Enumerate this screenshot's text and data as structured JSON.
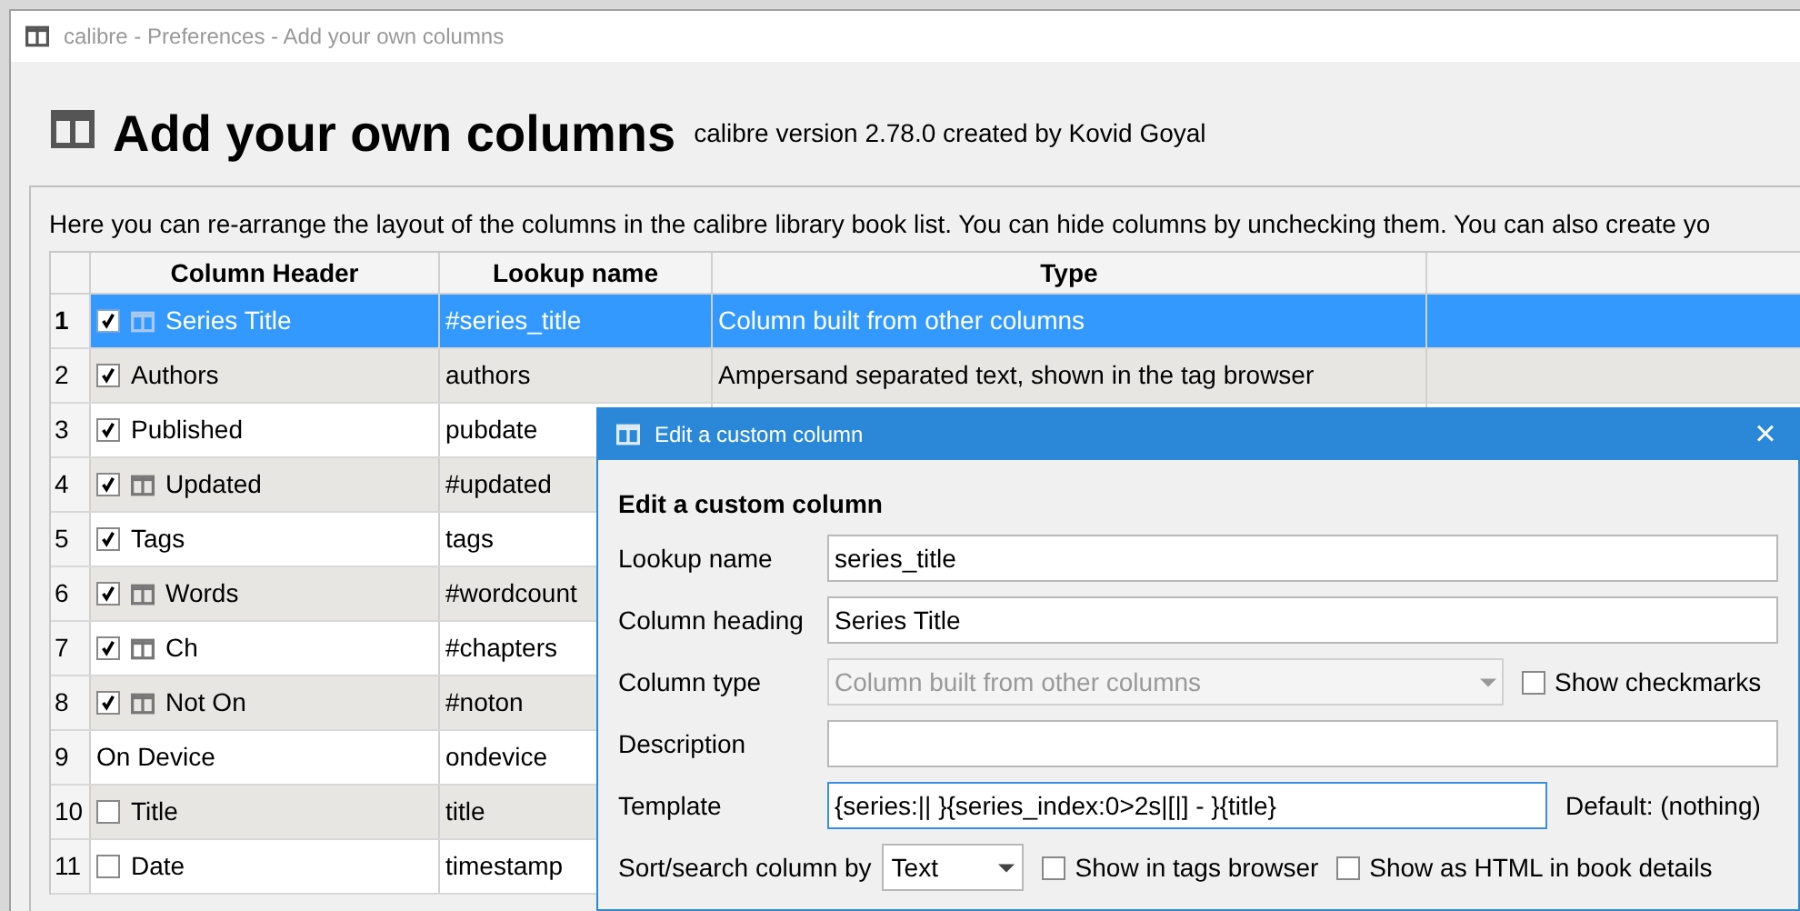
{
  "window": {
    "title": "calibre - Preferences - Add your own columns"
  },
  "heading": {
    "title": "Add your own columns",
    "subtitle": "calibre version 2.78.0 created by Kovid Goyal"
  },
  "description": "Here you can re-arrange the layout of the columns in the calibre library book list. You can hide columns by unchecking them. You can also create yo",
  "table": {
    "columns": [
      "Column Header",
      "Lookup name",
      "Type"
    ],
    "rows": [
      {
        "number": "1",
        "kind": "checkbox",
        "checked": true,
        "custom": true,
        "header": "Series Title",
        "lookup": "#series_title",
        "type": "Column built from other columns",
        "selected": true
      },
      {
        "number": "2",
        "kind": "checkbox",
        "checked": true,
        "custom": false,
        "header": "Authors",
        "lookup": "authors",
        "type": "Ampersand separated text, shown in the tag browser",
        "selected": false
      },
      {
        "number": "3",
        "kind": "checkbox",
        "checked": true,
        "custom": false,
        "header": "Published",
        "lookup": "pubdate",
        "selected": false
      },
      {
        "number": "4",
        "kind": "checkbox",
        "checked": true,
        "custom": true,
        "header": "Updated",
        "lookup": "#updated",
        "selected": false
      },
      {
        "number": "5",
        "kind": "checkbox",
        "checked": true,
        "custom": false,
        "header": "Tags",
        "lookup": "tags",
        "selected": false
      },
      {
        "number": "6",
        "kind": "checkbox",
        "checked": true,
        "custom": true,
        "header": "Words",
        "lookup": "#wordcount",
        "selected": false
      },
      {
        "number": "7",
        "kind": "checkbox",
        "checked": true,
        "custom": true,
        "header": "Ch",
        "lookup": "#chapters",
        "selected": false
      },
      {
        "number": "8",
        "kind": "checkbox",
        "checked": true,
        "custom": true,
        "header": "Not On",
        "lookup": "#noton",
        "selected": false
      },
      {
        "number": "9",
        "kind": "plain",
        "custom": false,
        "header": "On Device",
        "lookup": "ondevice",
        "selected": false
      },
      {
        "number": "10",
        "kind": "checkbox",
        "checked": false,
        "custom": false,
        "header": "Title",
        "lookup": "title",
        "selected": false
      },
      {
        "number": "11",
        "kind": "checkbox",
        "checked": false,
        "custom": false,
        "header": "Date",
        "lookup": "timestamp",
        "selected": false
      }
    ]
  },
  "dialog": {
    "title": "Edit a custom column",
    "close": "×",
    "heading": "Edit a custom column",
    "lookup_name": {
      "label": "Lookup name",
      "value": "series_title"
    },
    "column_heading": {
      "label": "Column heading",
      "value": "Series Title"
    },
    "column_type": {
      "label": "Column type",
      "value": "Column built from other columns",
      "disabled": true,
      "checkbox": {
        "label": "Show checkmarks",
        "checked": false
      }
    },
    "description": {
      "label": "Description"
    },
    "template": {
      "label": "Template",
      "value": "{series:|| }{series_index:0>2s|[|] - }{title}",
      "focused": true,
      "default": "Default: (nothing)"
    },
    "sort": {
      "label": "Sort/search column by",
      "value": "Text",
      "checkboxes": [
        {
          "label": "Show in tags browser",
          "checked": false
        },
        {
          "label": "Show as HTML in book details",
          "checked": false
        }
      ]
    }
  }
}
